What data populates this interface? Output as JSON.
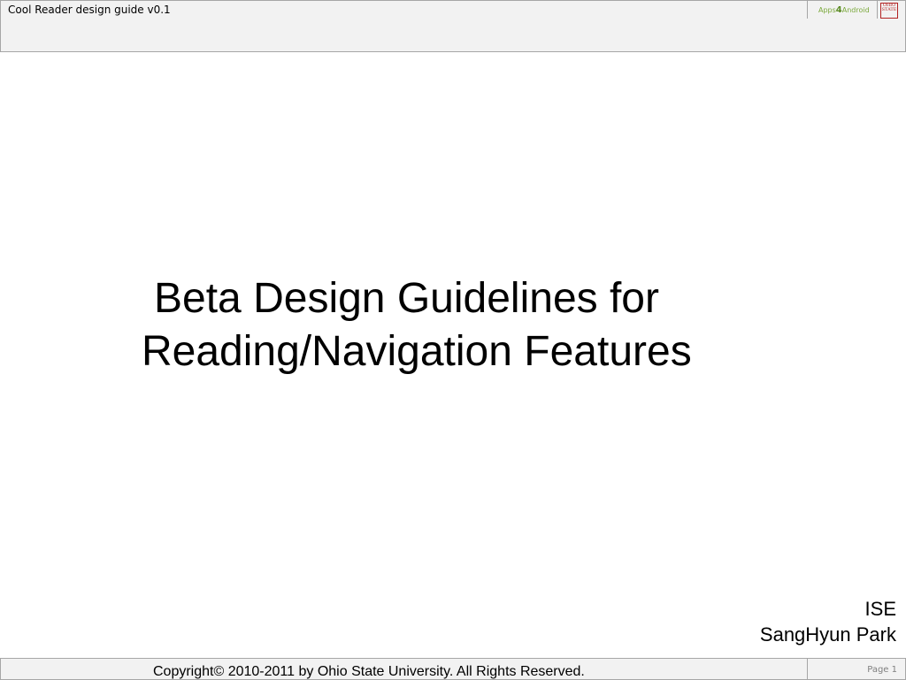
{
  "header": {
    "doc_title": "Cool Reader design guide v0.1",
    "logo_text": {
      "left": "Apps",
      "num": "4",
      "right": "Android"
    },
    "seal_text": [
      "OHIO",
      "STATE"
    ]
  },
  "slide": {
    "title_line1": "Beta Design Guidelines for",
    "title_line2": "Reading/Navigation Features",
    "dept": "ISE",
    "author": "SangHyun Park"
  },
  "footer": {
    "copyright": "Copyright© 2010-2011 by Ohio State University. All Rights Reserved.",
    "page_label": "Page 1"
  }
}
